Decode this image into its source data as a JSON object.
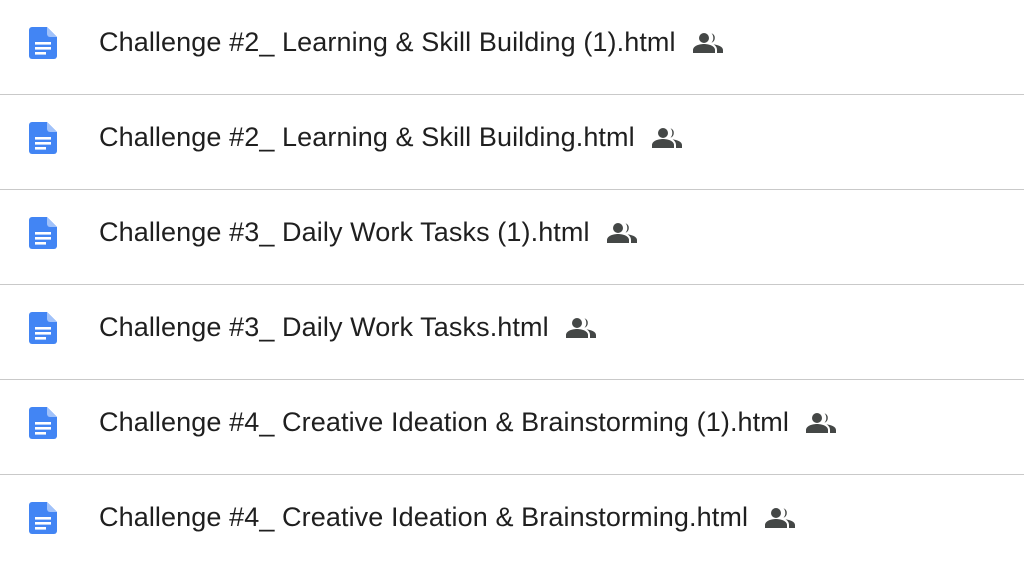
{
  "files": [
    {
      "name": "Challenge #2_ Learning & Skill Building (1).html",
      "type_icon": "google-docs-icon",
      "shared_icon": "shared-people-icon"
    },
    {
      "name": "Challenge #2_ Learning & Skill Building.html",
      "type_icon": "google-docs-icon",
      "shared_icon": "shared-people-icon"
    },
    {
      "name": "Challenge #3_ Daily Work Tasks (1).html",
      "type_icon": "google-docs-icon",
      "shared_icon": "shared-people-icon"
    },
    {
      "name": "Challenge #3_ Daily Work Tasks.html",
      "type_icon": "google-docs-icon",
      "shared_icon": "shared-people-icon"
    },
    {
      "name": "Challenge #4_ Creative Ideation & Brainstorming (1).html",
      "type_icon": "google-docs-icon",
      "shared_icon": "shared-people-icon"
    },
    {
      "name": "Challenge #4_ Creative Ideation & Brainstorming.html",
      "type_icon": "google-docs-icon",
      "shared_icon": "shared-people-icon"
    }
  ],
  "colors": {
    "doc_icon": "#4285f4",
    "shared_icon": "#444746",
    "text": "#1f1f1f",
    "divider": "#c9c9c9"
  }
}
